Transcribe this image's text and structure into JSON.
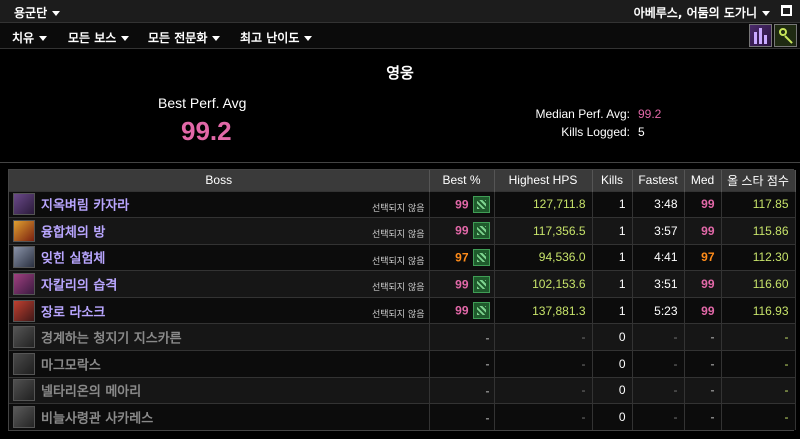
{
  "topbar": {
    "guild": "용군단",
    "character": "아베루스, 어둠의 도가니"
  },
  "menu": {
    "items": [
      "치유",
      "모든 보스",
      "모든 전문화",
      "최고 난이도"
    ]
  },
  "summary": {
    "difficulty": "영웅",
    "best_perf_label": "Best Perf. Avg",
    "best_perf_value": "99.2",
    "median_label": "Median Perf. Avg:",
    "median_value": "99.2",
    "kills_label": "Kills Logged:",
    "kills_value": "5"
  },
  "table": {
    "headers": [
      "Boss",
      "Best %",
      "Highest HPS",
      "Kills",
      "Fastest",
      "Med",
      "올 스타 점수"
    ],
    "rows": [
      {
        "name": "지옥벼림 카자라",
        "status": "선택되지 않음",
        "best": "99",
        "best_color": "#e268a8",
        "hps": "127,711.8",
        "kills": "1",
        "fastest": "3:48",
        "med": "99",
        "med_color": "#e268a8",
        "allstar": "117.85",
        "avatar": [
          "#6b4a8a",
          "#2a1a3a"
        ],
        "active": true
      },
      {
        "name": "융합체의 방",
        "status": "선택되지 않음",
        "best": "99",
        "best_color": "#e268a8",
        "hps": "117,356.5",
        "kills": "1",
        "fastest": "3:57",
        "med": "99",
        "med_color": "#e268a8",
        "allstar": "115.86",
        "avatar": [
          "#e0a030",
          "#7a2010"
        ],
        "active": true
      },
      {
        "name": "잊힌 실험체",
        "status": "선택되지 않음",
        "best": "97",
        "best_color": "#ff8c1a",
        "hps": "94,536.0",
        "kills": "1",
        "fastest": "4:41",
        "med": "97",
        "med_color": "#ff8c1a",
        "allstar": "112.30",
        "avatar": [
          "#8a93a8",
          "#2a3040"
        ],
        "active": true
      },
      {
        "name": "자칼리의 습격",
        "status": "선택되지 않음",
        "best": "99",
        "best_color": "#e268a8",
        "hps": "102,153.6",
        "kills": "1",
        "fastest": "3:51",
        "med": "99",
        "med_color": "#e268a8",
        "allstar": "116.60",
        "avatar": [
          "#a04080",
          "#3a1a40"
        ],
        "active": true
      },
      {
        "name": "장로 라소크",
        "status": "선택되지 않음",
        "best": "99",
        "best_color": "#e268a8",
        "hps": "137,881.3",
        "kills": "1",
        "fastest": "5:23",
        "med": "99",
        "med_color": "#e268a8",
        "allstar": "116.93",
        "avatar": [
          "#c04030",
          "#401818"
        ],
        "active": true
      },
      {
        "name": "경계하는 청지기 지스카른",
        "status": "",
        "best": "-",
        "best_color": "#888888",
        "hps": "-",
        "kills": "0",
        "fastest": "-",
        "med": "-",
        "med_color": "#888888",
        "allstar": "-",
        "avatar": [
          "#555555",
          "#222222"
        ],
        "active": false
      },
      {
        "name": "마그모락스",
        "status": "",
        "best": "-",
        "best_color": "#888888",
        "hps": "-",
        "kills": "0",
        "fastest": "-",
        "med": "-",
        "med_color": "#888888",
        "allstar": "-",
        "avatar": [
          "#4a4a4a",
          "#1e1e1e"
        ],
        "active": false
      },
      {
        "name": "넬타리온의 메아리",
        "status": "",
        "best": "-",
        "best_color": "#888888",
        "hps": "-",
        "kills": "0",
        "fastest": "-",
        "med": "-",
        "med_color": "#888888",
        "allstar": "-",
        "avatar": [
          "#505050",
          "#202020"
        ],
        "active": false
      },
      {
        "name": "비늘사령관 사카레스",
        "status": "",
        "best": "-",
        "best_color": "#888888",
        "hps": "-",
        "kills": "0",
        "fastest": "-",
        "med": "-",
        "med_color": "#888888",
        "allstar": "-",
        "avatar": [
          "#5a5a5a",
          "#242424"
        ],
        "active": false
      }
    ]
  }
}
